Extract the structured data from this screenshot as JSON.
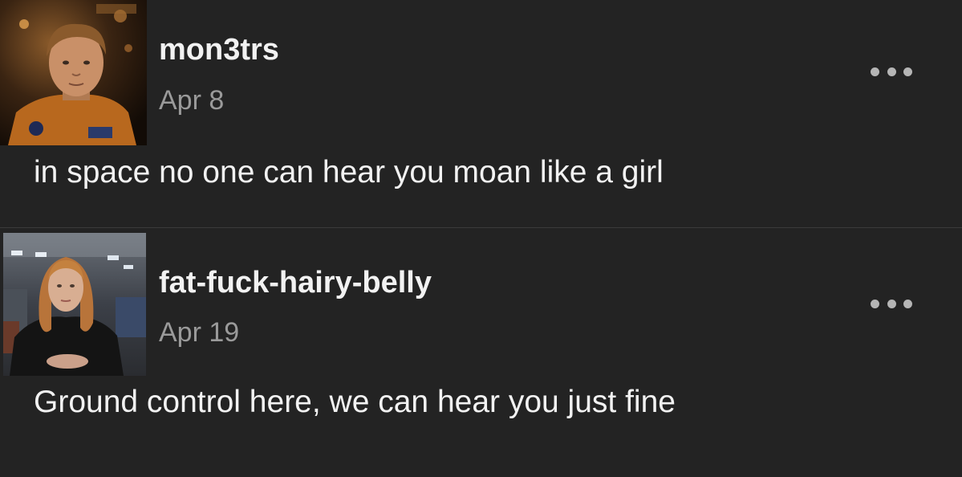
{
  "posts": [
    {
      "username": "mon3trs",
      "date": "Apr 8",
      "text": "in space no one can hear you moan like a girl",
      "avatar_icon": "astronaut-avatar-photo",
      "more_icon": "more-horizontal-icon"
    },
    {
      "username": "fat-fuck-hairy-belly",
      "date": "Apr 19",
      "text": "Ground control here, we can hear you just fine",
      "avatar_icon": "woman-avatar-photo",
      "more_icon": "more-horizontal-icon"
    }
  ],
  "colors": {
    "background": "#232323",
    "text_primary": "#f2f2f2",
    "text_secondary": "#9a9a9a",
    "divider": "#3a3a3a",
    "more_dots": "#b5b5b5"
  }
}
